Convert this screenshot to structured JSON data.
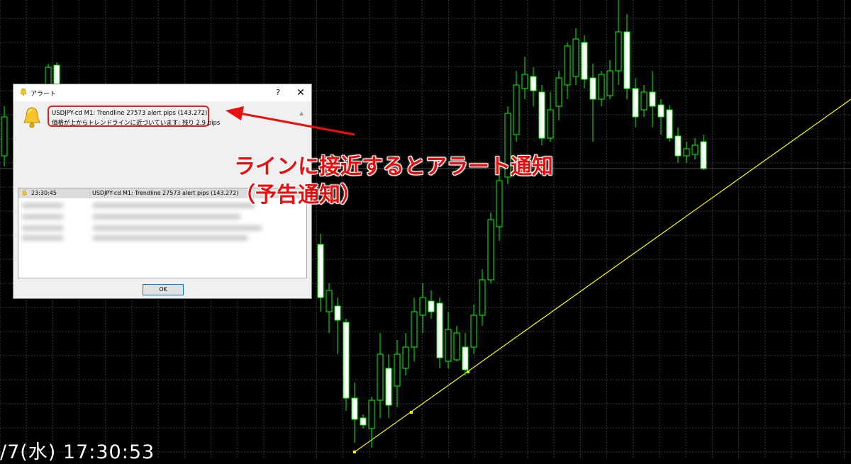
{
  "chart": {
    "timestamp": "/7(水) 17:30:53",
    "colors": {
      "background": "#000000",
      "grid": "#3a3a3a",
      "candle_up": "#000000",
      "candle_down": "#ffffff",
      "wick": "#00ff00",
      "trendline": "#ffff00",
      "price_line": "#4a4a4a"
    }
  },
  "dialog": {
    "title": "アラート",
    "help_label": "?",
    "close_label": "✕",
    "message_line1": "USDJPY-cd M1: Trendline 27573 alert pips (143.272)",
    "message_line2": "価格が上からトレンドラインに近づいています: 残り 2.9 pips",
    "log": [
      {
        "time": "23:30:45",
        "message": "USDJPY-cd M1: Trendline 27573 alert pips (143.272)"
      }
    ],
    "ok_label": "OK",
    "icon": "bell-icon"
  },
  "annotation": {
    "line1": "ラインに接近するとアラート通知",
    "line2": "（予告通知）",
    "color": "#e8100f"
  }
}
